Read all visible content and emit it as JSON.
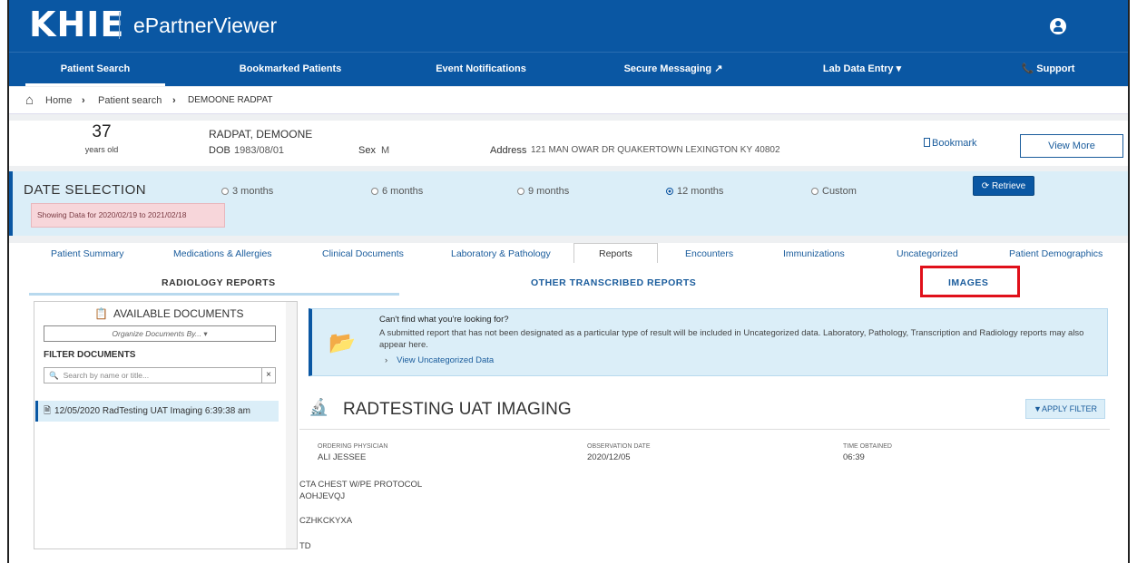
{
  "header": {
    "logo": "KHIE",
    "app_title": "ePartnerViewer"
  },
  "nav": [
    {
      "label": "Patient Search"
    },
    {
      "label": "Bookmarked Patients"
    },
    {
      "label": "Event Notifications"
    },
    {
      "label": "Secure Messaging ↗"
    },
    {
      "label": "Lab Data Entry ▾"
    },
    {
      "label": "📞 Support"
    }
  ],
  "breadcrumb": {
    "home": "Home",
    "search": "Patient search",
    "current": "DEMOONE RADPAT"
  },
  "patient": {
    "age": "37",
    "age_unit": "years old",
    "name": "RADPAT, DEMOONE",
    "dob_label": "DOB",
    "dob": "1983/08/01",
    "sex_label": "Sex",
    "sex": "M",
    "address_label": "Address",
    "address": "121 MAN OWAR DR QUAKERTOWN LEXINGTON KY 40802",
    "bookmark": "Bookmark",
    "view_more": "View More"
  },
  "date_selection": {
    "title": "DATE SELECTION",
    "showing": "Showing Data for 2020/02/19 to 2021/02/18",
    "options": [
      "3 months",
      "6 months",
      "9 months",
      "12 months",
      "Custom"
    ],
    "selected": "12 months",
    "retrieve": "Retrieve"
  },
  "tabs": [
    "Patient Summary",
    "Medications & Allergies",
    "Clinical Documents",
    "Laboratory & Pathology",
    "Reports",
    "Encounters",
    "Immunizations",
    "Uncategorized",
    "Patient Demographics"
  ],
  "subtabs": [
    "RADIOLOGY REPORTS",
    "OTHER TRANSCRIBED REPORTS",
    "IMAGES"
  ],
  "left_panel": {
    "title": "AVAILABLE DOCUMENTS",
    "organize": "Organize Documents By...",
    "filter_title": "FILTER DOCUMENTS",
    "search_placeholder": "Search by name or title...",
    "document": "12/05/2020 RadTesting UAT Imaging 6:39:38 am"
  },
  "banner": {
    "title": "Can't find what you're looking for?",
    "text": "A submitted report that has not been designated as a particular type of result will be included in Uncategorized data. Laboratory, Pathology, Transcription and Radiology reports may also appear here.",
    "link": "View Uncategorized Data"
  },
  "report": {
    "title": "RADTESTING UAT IMAGING",
    "apply_filter": "APPLY FILTER",
    "ordering_label": "ORDERING PHYSICIAN",
    "ordering": "ALI JESSEE",
    "obs_label": "OBSERVATION DATE",
    "obs": "2020/12/05",
    "time_label": "TIME OBTAINED",
    "time": "06:39",
    "line1": "CTA CHEST W/PE PROTOCOL",
    "line2": "AOHJEVQJ",
    "line3": "CZHKCKYXA",
    "line4": "TD"
  },
  "colors": {
    "primary": "#0a57a3",
    "banner": "#dbeef8",
    "highlight": "#e0101a",
    "alert": "#f7d6da"
  }
}
